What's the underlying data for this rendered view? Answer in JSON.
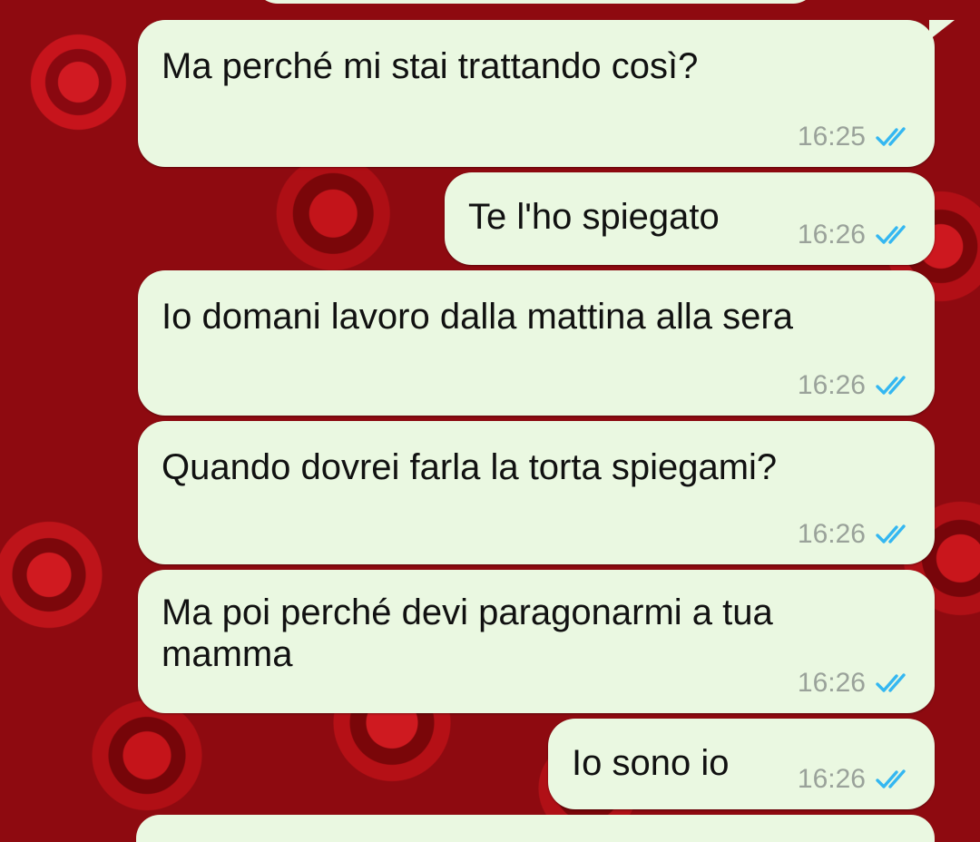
{
  "chat": {
    "messages": [
      {
        "text": "Ma perché mi stai trattando così?",
        "time": "16:25",
        "status": "read"
      },
      {
        "text": "Te l'ho spiegato",
        "time": "16:26",
        "status": "read"
      },
      {
        "text": "Io domani lavoro dalla mattina alla sera",
        "time": "16:26",
        "status": "read"
      },
      {
        "text": "Quando dovrei farla la torta spiegami?",
        "time": "16:26",
        "status": "read"
      },
      {
        "text": "Ma poi perché devi paragonarmi a tua mamma",
        "time": "16:26",
        "status": "read"
      },
      {
        "text": "Io sono io",
        "time": "16:26",
        "status": "read"
      }
    ]
  },
  "colors": {
    "bubble": "#eaf8e1",
    "read_ticks": "#34b7f1",
    "timestamp": "#9aa29a",
    "background": "#8e0a10"
  },
  "icons": {
    "read_receipt": "double-check-icon"
  }
}
